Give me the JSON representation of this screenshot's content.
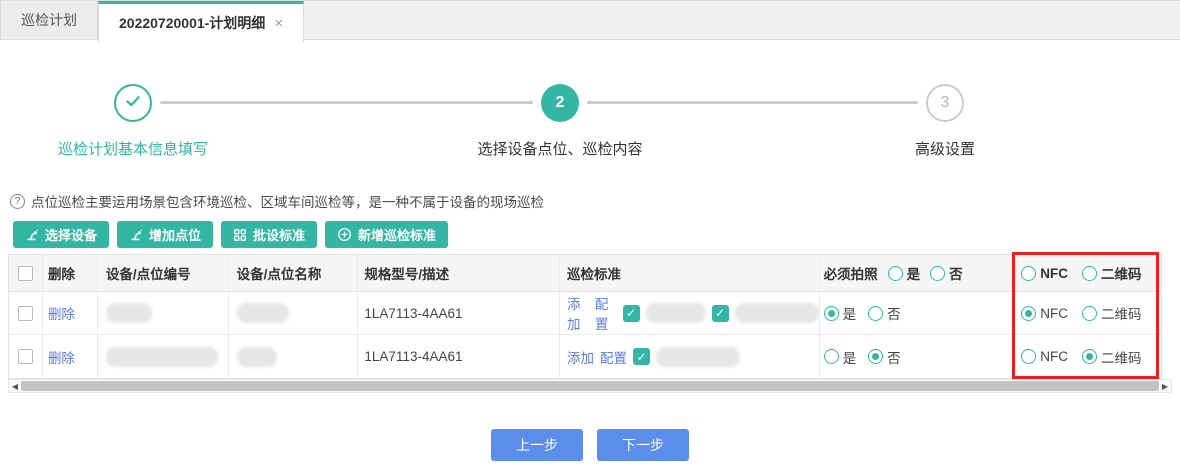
{
  "tabs": {
    "items": [
      {
        "label": "巡检计划",
        "active": false
      },
      {
        "label": "20220720001-计划明细",
        "active": true
      }
    ],
    "close_icon": "×"
  },
  "stepper": {
    "steps": [
      {
        "num": "",
        "label": "巡检计划基本信息填写",
        "state": "done"
      },
      {
        "num": "2",
        "label": "选择设备点位、巡检内容",
        "state": "active"
      },
      {
        "num": "3",
        "label": "高级设置",
        "state": "pending"
      }
    ]
  },
  "tip": {
    "icon": "?",
    "text": "点位巡检主要运用场景包含环境巡检、区域车间巡检等，是一种不属于设备的现场巡检"
  },
  "toolbar": {
    "buttons": [
      {
        "label": "选择设备",
        "icon": "robot-arm-icon"
      },
      {
        "label": "增加点位",
        "icon": "robot-arm-icon"
      },
      {
        "label": "批设标准",
        "icon": "grid-icon"
      },
      {
        "label": "新增巡检标准",
        "icon": "plus-circle-icon"
      }
    ]
  },
  "table": {
    "headers": {
      "delete": "删除",
      "code": "设备/点位编号",
      "name": "设备/点位名称",
      "spec": "规格型号/描述",
      "standard": "巡检标准",
      "photo": "必须拍照",
      "yes": "是",
      "no": "否",
      "nfc": "NFC",
      "qr": "二维码"
    },
    "rows": [
      {
        "delete": "删除",
        "code_redacted_w": 46,
        "name_redacted_w": 52,
        "spec": "1LA7113-4AA61",
        "add": "添加",
        "config": "配置",
        "standards": [
          {
            "checked": true,
            "redacted_w": 60
          },
          {
            "checked": true,
            "redacted_w": 84
          }
        ],
        "photo": "yes",
        "tag": "nfc"
      },
      {
        "delete": "删除",
        "code_redacted_w": 112,
        "name_redacted_w": 40,
        "spec": "1LA7113-4AA61",
        "add": "添加",
        "config": "配置",
        "standards": [
          {
            "checked": true,
            "redacted_w": 84
          }
        ],
        "photo": "no",
        "tag": "qr"
      }
    ]
  },
  "footer": {
    "prev": "上一步",
    "next": "下一步"
  },
  "colors": {
    "teal": "#33b6a4",
    "blue": "#5b8deb",
    "link": "#5d7ce2",
    "red": "#f21d1d"
  }
}
